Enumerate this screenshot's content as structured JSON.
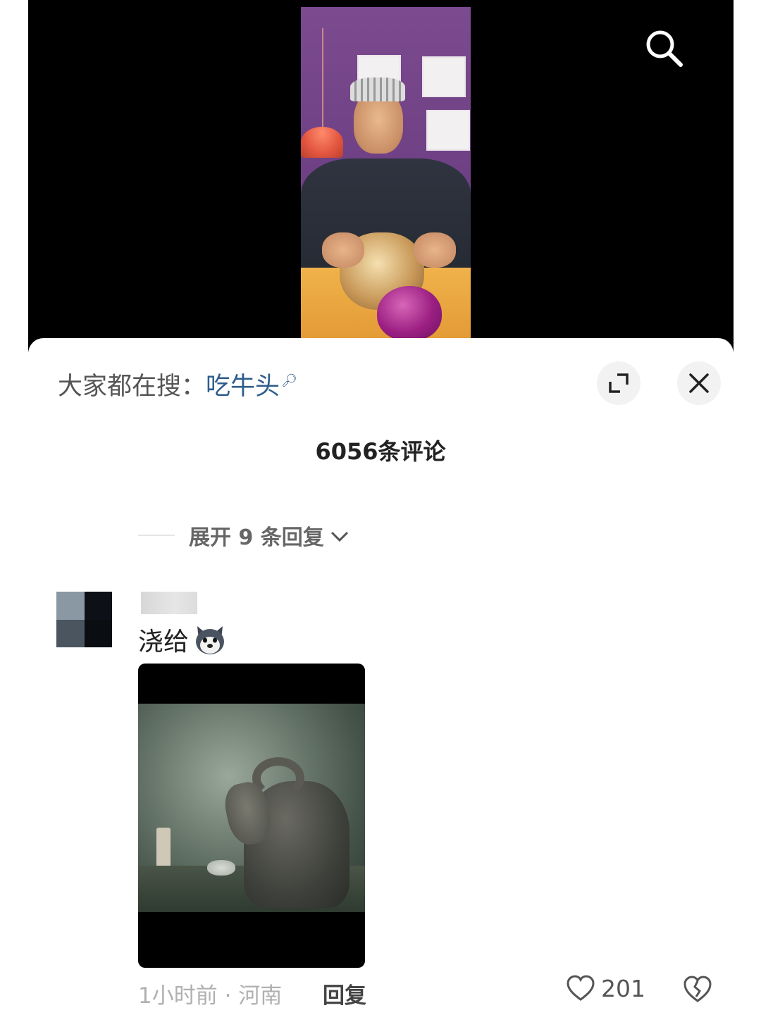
{
  "header": {
    "search_icon": "search-icon"
  },
  "hot_search": {
    "prefix": "大家都在搜：",
    "keyword": "吃牛头",
    "keyword_icon": "magnifier-small-icon"
  },
  "actions": {
    "expand_icon": "expand-icon",
    "close_icon": "close-icon"
  },
  "comments_header": {
    "count_text": "6056条评论"
  },
  "replies": {
    "expand_text": "展开 9 条回复",
    "chevron_icon": "chevron-down-icon"
  },
  "comment": {
    "username": "",
    "text": "浇给",
    "emoji": "husky-dog-emoji",
    "time_location": "1小时前 · 河南",
    "reply_label": "回复",
    "likes": "201",
    "like_icon": "heart-icon",
    "dislike_icon": "broken-heart-icon"
  },
  "colors": {
    "keyword": "#2f5d8c",
    "video_bg": "#000000",
    "sheet_bg": "#ffffff",
    "muted_text": "#b0b0b0"
  }
}
